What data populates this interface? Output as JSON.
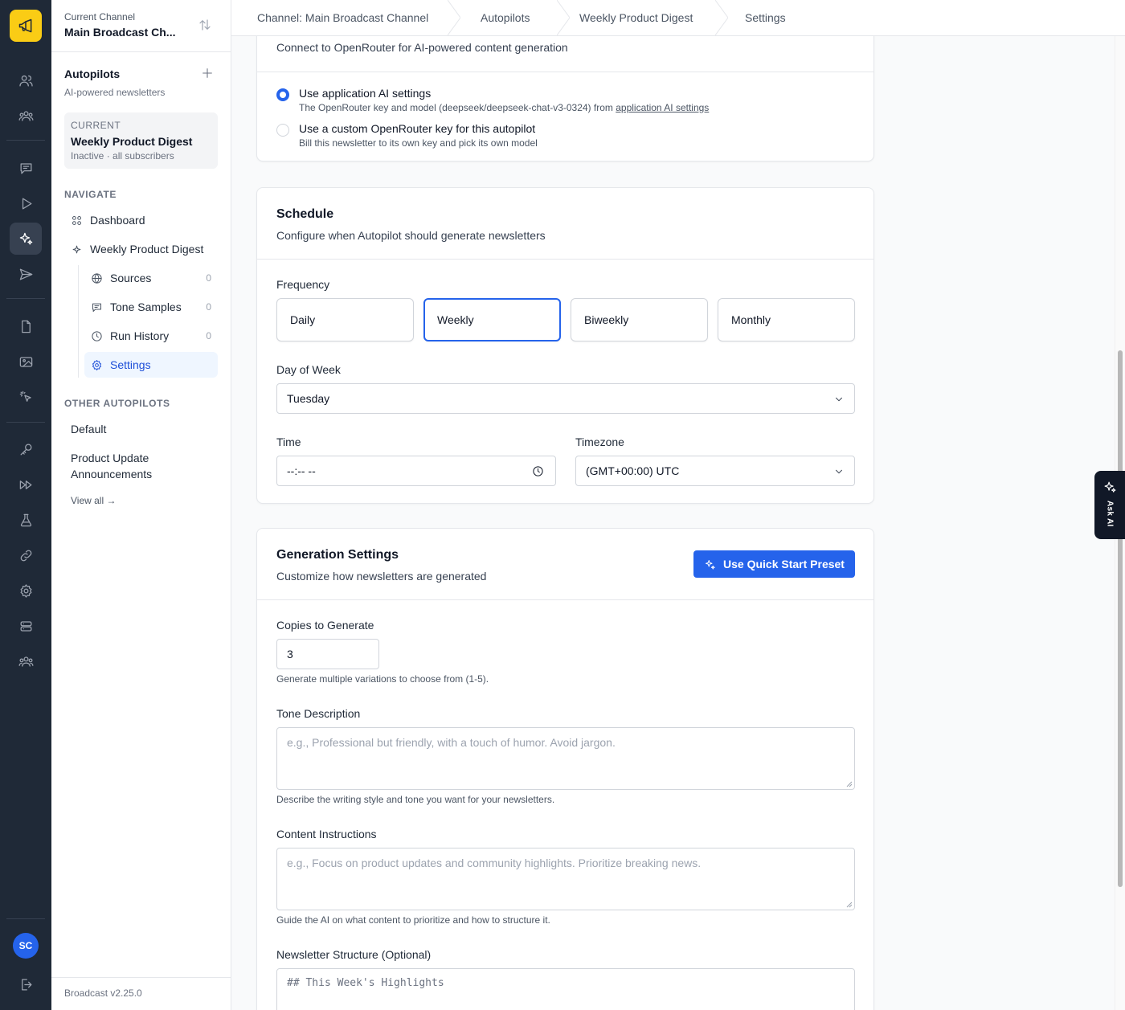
{
  "rail": {
    "avatar_initials": "SC"
  },
  "sidebar": {
    "channel_label": "Current Channel",
    "channel_name": "Main Broadcast Ch...",
    "autopilots_title": "Autopilots",
    "autopilots_subtitle": "AI-powered newsletters",
    "current": {
      "label": "CURRENT",
      "name": "Weekly Product Digest",
      "status": "Inactive · all subscribers"
    },
    "navigate_heading": "NAVIGATE",
    "nav": {
      "dashboard": "Dashboard",
      "digest": "Weekly Product Digest",
      "sources": "Sources",
      "sources_count": "0",
      "tone_samples": "Tone Samples",
      "tone_samples_count": "0",
      "run_history": "Run History",
      "run_history_count": "0",
      "settings": "Settings"
    },
    "other_heading": "OTHER AUTOPILOTS",
    "other": [
      "Default",
      "Product Update Announcements"
    ],
    "view_all": "View all →",
    "version": "Broadcast v2.25.0"
  },
  "breadcrumb": [
    "Channel: Main Broadcast Channel",
    "Autopilots",
    "Weekly Product Digest",
    "Settings"
  ],
  "ai_card": {
    "desc": "Connect to OpenRouter for AI-powered content generation",
    "option1_label": "Use application AI settings",
    "option1_help": "The OpenRouter key and model (deepseek/deepseek-chat-v3-0324) from",
    "option1_link": "application AI settings",
    "option2_label": "Use a custom OpenRouter key for this autopilot",
    "option2_help": "Bill this newsletter to its own key and pick its own model"
  },
  "schedule": {
    "title": "Schedule",
    "desc": "Configure when Autopilot should generate newsletters",
    "frequency_label": "Frequency",
    "frequencies": [
      "Daily",
      "Weekly",
      "Biweekly",
      "Monthly"
    ],
    "selected_frequency": "Weekly",
    "day_label": "Day of Week",
    "day_value": "Tuesday",
    "time_label": "Time",
    "time_value": "--:-- --",
    "timezone_label": "Timezone",
    "timezone_value": "(GMT+00:00) UTC"
  },
  "generation": {
    "title": "Generation Settings",
    "desc": "Customize how newsletters are generated",
    "preset_button": "Use Quick Start Preset",
    "copies_label": "Copies to Generate",
    "copies_value": "3",
    "copies_help": "Generate multiple variations to choose from (1-5).",
    "tone_label": "Tone Description",
    "tone_placeholder": "e.g., Professional but friendly, with a touch of humor. Avoid jargon.",
    "tone_help": "Describe the writing style and tone you want for your newsletters.",
    "content_label": "Content Instructions",
    "content_placeholder": "e.g., Focus on product updates and community highlights. Prioritize breaking news.",
    "content_help": "Guide the AI on what content to prioritize and how to structure it.",
    "structure_label": "Newsletter Structure (Optional)",
    "structure_placeholder": "## This Week's Highlights"
  },
  "ask_ai": "Ask AI",
  "colors": {
    "rail_bg": "#1f2937",
    "logo_bg": "#facc15",
    "accent": "#2563eb"
  }
}
